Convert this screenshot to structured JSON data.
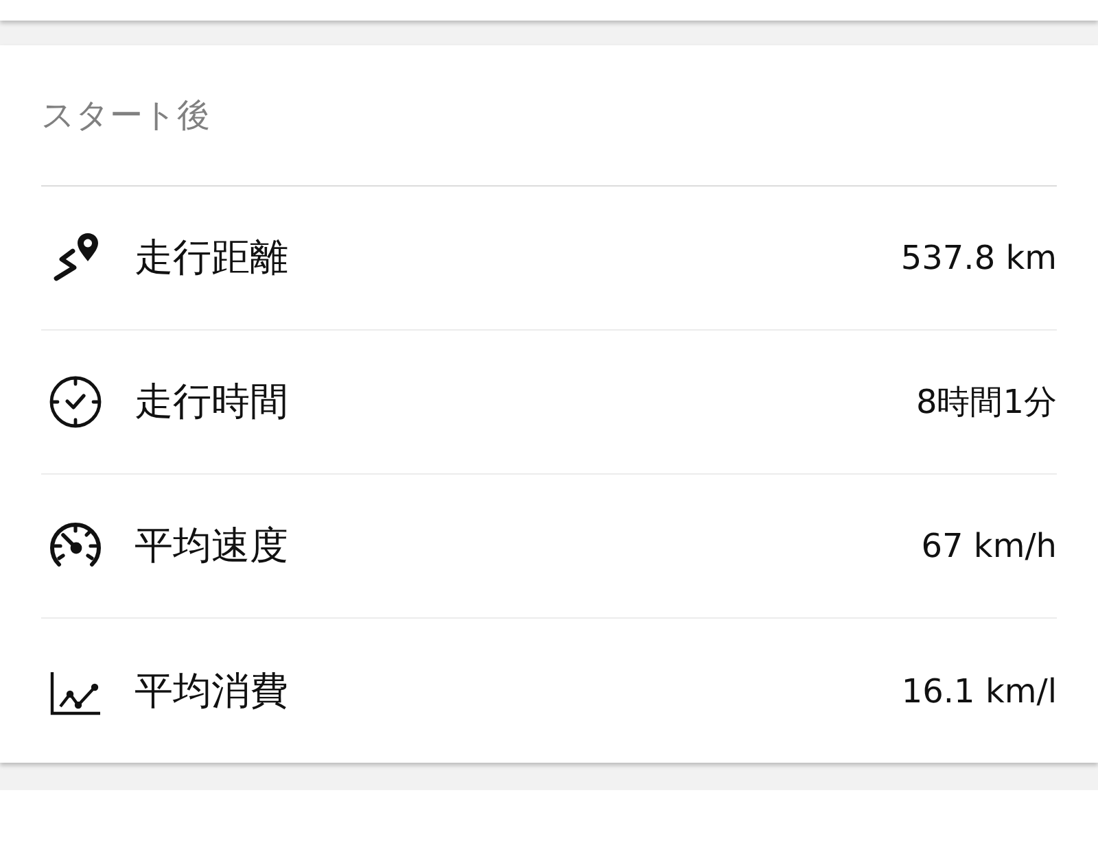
{
  "sections": [
    {
      "title": "スタート後",
      "rows": [
        {
          "kind": "distance",
          "label": "走行距離",
          "value": "537.8 km"
        },
        {
          "kind": "time",
          "label": "走行時間",
          "value": "8時間1分"
        },
        {
          "kind": "speed",
          "label": "平均速度",
          "value": "67 km/h"
        },
        {
          "kind": "consumption",
          "label": "平均消費",
          "value": "16.1 km/l"
        }
      ]
    }
  ]
}
